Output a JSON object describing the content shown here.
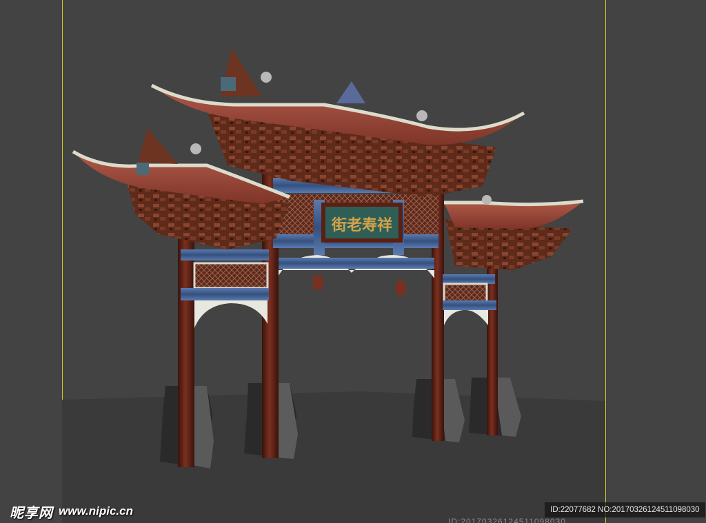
{
  "scene": {
    "name": "3D paifang archway model in a modeling-software viewport",
    "plaque_text": "街老寿祥",
    "colors": {
      "background": "#434343",
      "floor": "#3a3a3a",
      "safe_frame": "#c8c832",
      "roof_tile": "#9c4a3c",
      "roof_edge": "#d8d8c8",
      "bracket_wood": "#6e3422",
      "pillar": "#5a2014",
      "beam_blue": "#3d5a8a",
      "plaque_teal": "#2f5e57",
      "plaque_text": "#d2a24a",
      "stone_base": "#2c2c2c"
    }
  },
  "watermark": {
    "logo": "昵享网",
    "url": "www.nipic.cn",
    "id_text": "ID:22077682 NO:20170326124511098030",
    "faint_text": "ID:20170326124511098030"
  }
}
